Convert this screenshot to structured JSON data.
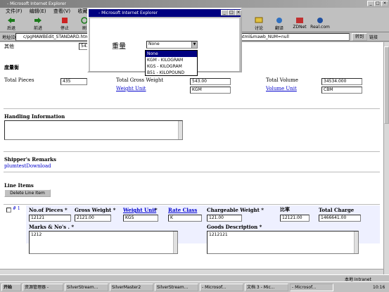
{
  "window": {
    "title": "- Microsoft Internet Explorer"
  },
  "menu": [
    "文件(F)",
    "编辑(E)",
    "查看(V)",
    "收藏(A)"
  ],
  "toolbar": {
    "left": [
      {
        "label": "后退",
        "icon": "back-arrow-icon"
      },
      {
        "label": "前进",
        "icon": "forward-arrow-icon"
      },
      {
        "label": "停止",
        "icon": "stop-icon"
      },
      {
        "label": "刷",
        "icon": "refresh-icon"
      }
    ],
    "right": [
      {
        "label": "讨论",
        "icon": "discuss-icon"
      },
      {
        "label": "翻译",
        "icon": "translate-icon"
      },
      {
        "label": "ZDNet",
        "icon": "zdnet-icon"
      },
      {
        "label": "Real.com",
        "icon": "real-icon"
      }
    ]
  },
  "address": {
    "label": "地址(D)",
    "value_left": "c/pgMAWBEdit_STANDARD.htm",
    "value_right": "der?page_Name=pgMAWBList.html&mawb_NUM=null",
    "go_label": "转到",
    "links_label": "链接"
  },
  "popup": {
    "title": "- Microsoft Internet Explorer",
    "field_label": "重量",
    "select_value": "None",
    "options": [
      "None",
      "KGM - KILOGRAM",
      "KGS - KILOGRAM",
      "B51 - KILOPOUND"
    ],
    "selected_index": 0
  },
  "page": {
    "other_label": "其他",
    "other_value": "543",
    "measure_title": "度量衡",
    "total_pieces_label": "Total Pieces",
    "total_pieces_value": "435",
    "total_gross_weight_label": "Total Gross Weight",
    "total_gross_weight_value": "543.00",
    "weight_unit_link": "Weight Unit",
    "weight_unit_value": "KGM",
    "total_volume_label": "Total Volume",
    "total_volume_value": "34534.000",
    "volume_unit_link": "Volume Unit",
    "volume_unit_value": "CBM",
    "handling_title": "Handling Information",
    "shipper_title": "Shipper's Remarks",
    "shipper_value": "plumtestDownload",
    "line_items_title": "Line Items",
    "delete_line_item_label": "Delete Line Item",
    "row_number": "# 1",
    "col_pieces": "No.of Pieces *",
    "col_gross": "Gross Weight *",
    "col_weight_unit": "Weight Unit",
    "col_rate_class": "Rate Class",
    "col_chargeable": "Chargeable Weight *",
    "col_ratio": "比率",
    "col_total_charge": "Total Charge",
    "star": "*",
    "pieces_value": "12121",
    "gross_value": "2121.00",
    "weight_unit_row_value": "KGS",
    "rate_class_value": "K",
    "chargeable_value": "121.00",
    "ratio_value": "12121.00",
    "total_charge_value": "1466641.00",
    "marks_label": "Marks & No's . *",
    "marks_value": "1212",
    "goods_label": "Goods Description *",
    "goods_value": "1212121"
  },
  "status": {
    "zone": "本地 Intranet"
  },
  "taskbar": {
    "start_label": "开始",
    "items": [
      "资源管理器 -",
      "SilverStream...",
      "SilverMaster2",
      "SilverStream...",
      "- Microsof...",
      "文档 3 - Mic...",
      "- Microsof..."
    ],
    "clock": "10:16"
  }
}
